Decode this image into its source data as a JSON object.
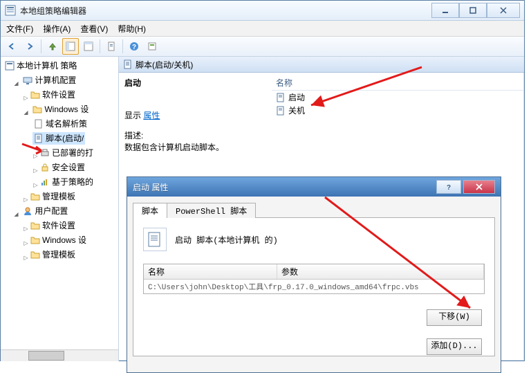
{
  "window": {
    "title": "本地组策略编辑器"
  },
  "menu": {
    "file": "文件(F)",
    "action": "操作(A)",
    "view": "查看(V)",
    "help": "帮助(H)"
  },
  "tree": {
    "root": "本地计算机 策略",
    "computer": "计算机配置",
    "comp_software": "软件设置",
    "comp_windows": "Windows 设",
    "dns": "域名解析策",
    "scripts": "脚本(启动/",
    "deployed": "已部署的打",
    "security": "安全设置",
    "policy_based": "基于策略的",
    "admin_templates": "管理模板",
    "user": "用户配置",
    "user_software": "软件设置",
    "user_windows": "Windows 设",
    "user_admin": "管理模板"
  },
  "content": {
    "header": "脚本(启动/关机)",
    "startup": "启动",
    "show": "显示",
    "properties": "属性",
    "desc_label": "描述:",
    "desc_text": "数据包含计算机启动脚本。",
    "col_name": "名称",
    "item_startup": "启动",
    "item_shutdown": "关机"
  },
  "dialog": {
    "title": "启动 属性",
    "tab_script": "脚本",
    "tab_ps": "PowerShell 脚本",
    "head": "启动 脚本(本地计算机 的)",
    "col_name": "名称",
    "col_param": "参数",
    "path": "C:\\Users\\john\\Desktop\\工具\\frp_0.17.0_windows_amd64\\frpc.vbs",
    "btn_down": "下移(W)",
    "btn_add": "添加(D)..."
  }
}
